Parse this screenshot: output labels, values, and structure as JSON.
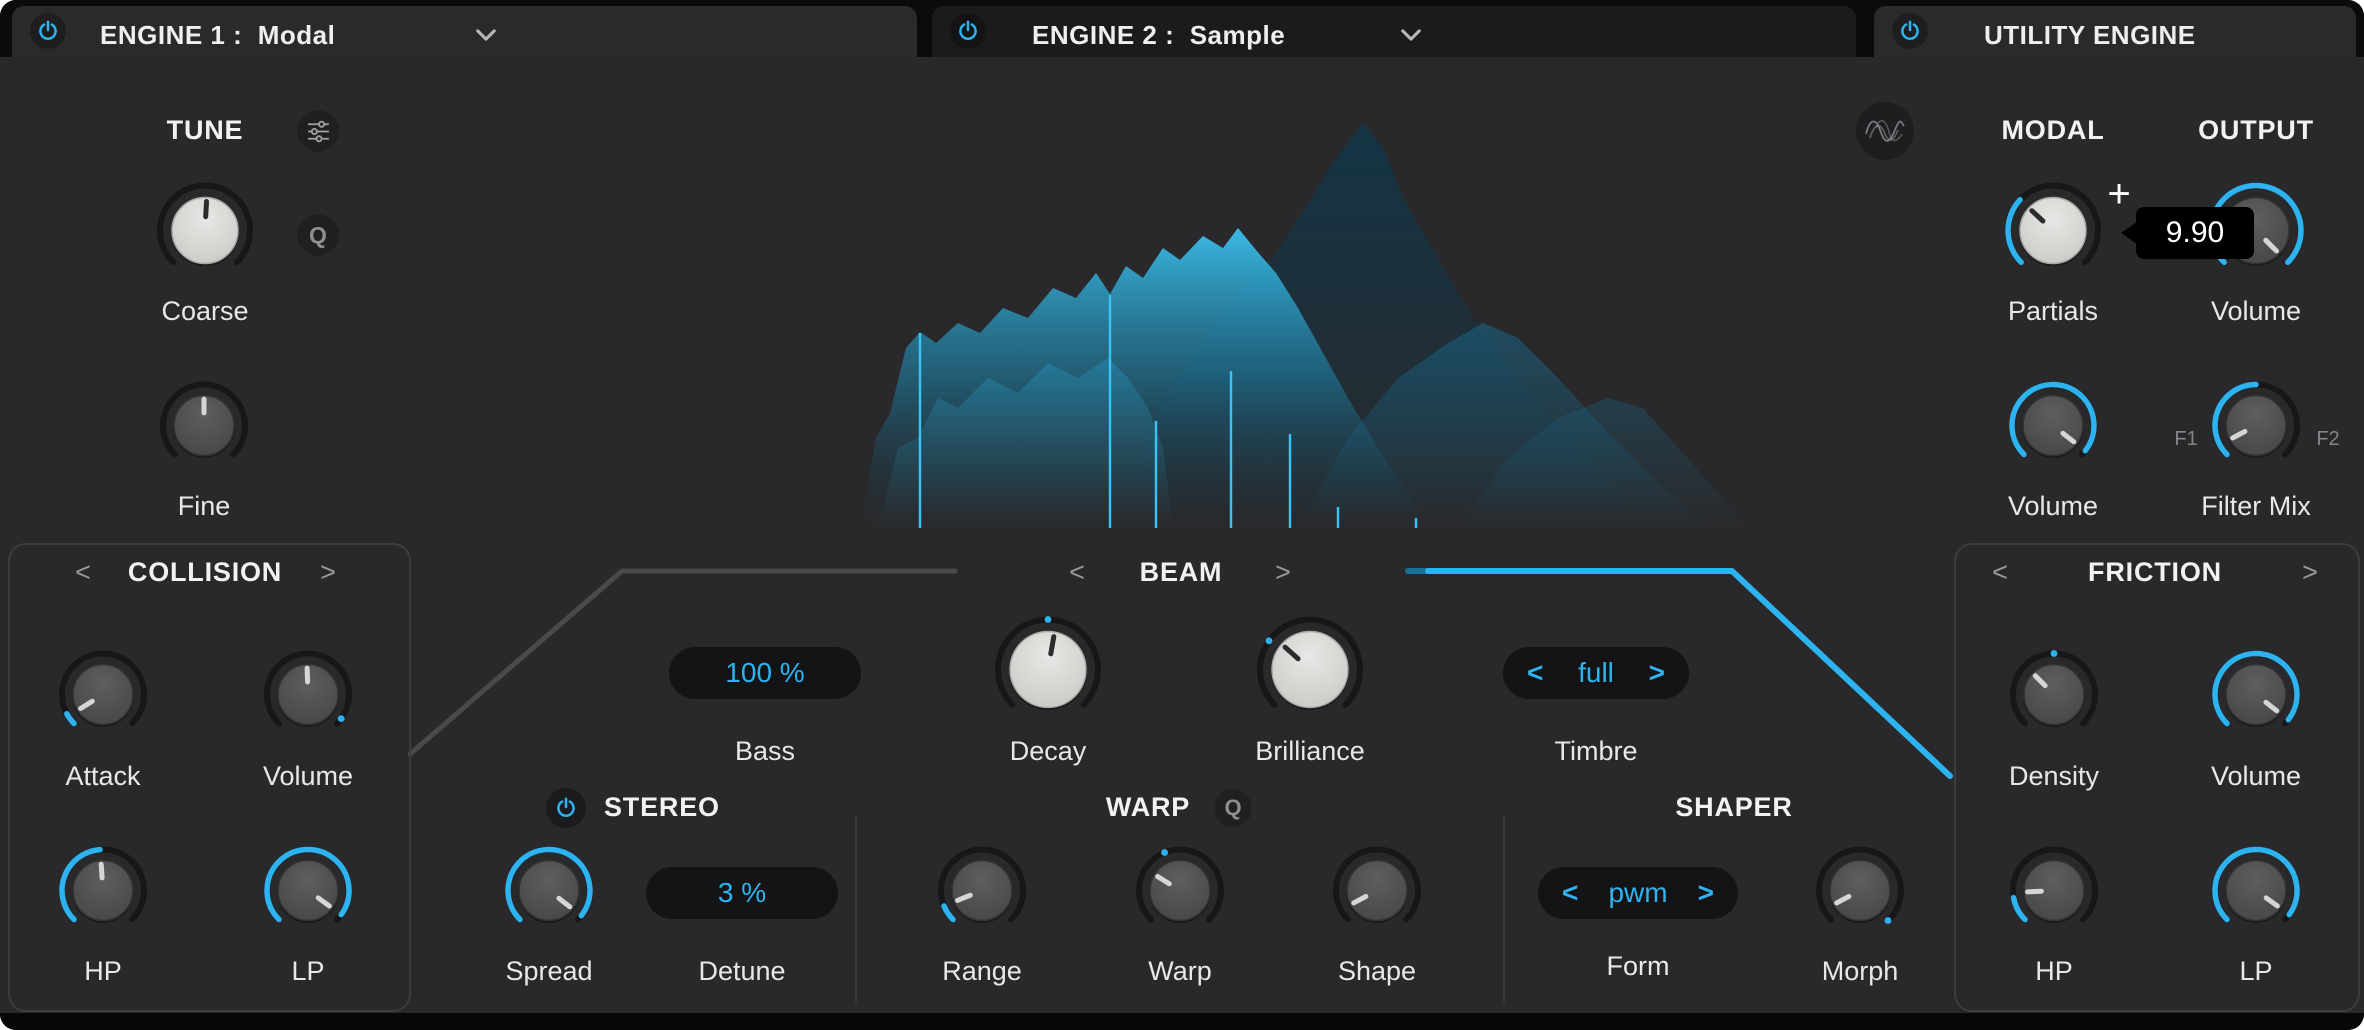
{
  "accent": "#2db4f0",
  "ui": {
    "prev": "<",
    "next": ">",
    "plus": "+"
  },
  "tabs": [
    {
      "label": "ENGINE 1 :  Modal"
    },
    {
      "label": "ENGINE 2 :  Sample"
    },
    {
      "label": "UTILITY ENGINE"
    }
  ],
  "sections": {
    "tune": "TUNE",
    "collision": "COLLISION",
    "beam": "BEAM",
    "stereo": "STEREO",
    "warp": "WARP",
    "shaper": "SHAPER",
    "modal": "MODAL",
    "output": "OUTPUT",
    "friction": "FRICTION"
  },
  "buttons": {
    "quantize_tune": "Q",
    "quantize_warp": "Q"
  },
  "fields": {
    "bass": {
      "label": "Bass",
      "value": "100 %"
    },
    "timbre": {
      "label": "Timbre",
      "value": "full"
    },
    "detune": {
      "label": "Detune",
      "value": "3 %"
    },
    "form": {
      "label": "Form",
      "value": "pwm"
    }
  },
  "tooltip": {
    "value": "9.90"
  },
  "filter_mix_labels": {
    "min": "F1",
    "max": "F2"
  },
  "knobs": {
    "coarse": {
      "label": "Coarse",
      "style": "light",
      "size": "m",
      "deg": 3,
      "arc": null,
      "ticks": []
    },
    "fine": {
      "label": "Fine",
      "style": "gray",
      "size": "s",
      "deg": 0,
      "arc": null,
      "ticks": []
    },
    "col_attack": {
      "label": "Attack",
      "style": "gray",
      "size": "s",
      "deg": -122,
      "arc": [
        -135,
        -118
      ],
      "ticks": []
    },
    "col_volume": {
      "label": "Volume",
      "style": "gray",
      "size": "s",
      "deg": -2,
      "arc": null,
      "ticks": [
        126
      ]
    },
    "col_hp": {
      "label": "HP",
      "style": "gray",
      "size": "s",
      "deg": -4,
      "arc": [
        -135,
        -4
      ],
      "ticks": []
    },
    "col_lp": {
      "label": "LP",
      "style": "gray",
      "size": "s",
      "deg": 126,
      "arc": [
        -135,
        126
      ],
      "ticks": []
    },
    "decay": {
      "label": "Decay",
      "style": "light",
      "size": "l",
      "deg": 10,
      "arc": null,
      "ticks": [
        0
      ]
    },
    "brilliance": {
      "label": "Brilliance",
      "style": "light",
      "size": "l",
      "deg": -48,
      "arc": null,
      "ticks": [
        -55
      ]
    },
    "spread": {
      "label": "Spread",
      "style": "gray",
      "size": "s",
      "deg": 128,
      "arc": [
        -135,
        128
      ],
      "ticks": []
    },
    "range": {
      "label": "Range",
      "style": "gray",
      "size": "s",
      "deg": -112,
      "arc": [
        -135,
        -112
      ],
      "ticks": []
    },
    "warp": {
      "label": "Warp",
      "style": "gray",
      "size": "s",
      "deg": -58,
      "arc": null,
      "ticks": [
        -22
      ]
    },
    "shape": {
      "label": "Shape",
      "style": "gray",
      "size": "s",
      "deg": -118,
      "arc": null,
      "ticks": []
    },
    "morph": {
      "label": "Morph",
      "style": "gray",
      "size": "s",
      "deg": -118,
      "arc": null,
      "ticks": [
        137
      ]
    },
    "partials": {
      "label": "Partials",
      "style": "light",
      "size": "m",
      "deg": -47,
      "arc": [
        -135,
        -47
      ],
      "ticks": []
    },
    "out_volume": {
      "label": "Volume",
      "style": "gray",
      "size": "m",
      "deg": 135,
      "arc": [
        -135,
        135
      ],
      "ticks": []
    },
    "util_volume": {
      "label": "Volume",
      "style": "gray",
      "size": "s",
      "deg": 128,
      "arc": [
        -135,
        128
      ],
      "ticks": []
    },
    "filter_mix": {
      "label": "Filter Mix",
      "style": "gray",
      "size": "s",
      "deg": -118,
      "arc": [
        -135,
        0
      ],
      "ticks": []
    },
    "density": {
      "label": "Density",
      "style": "gray",
      "size": "s",
      "deg": -45,
      "arc": null,
      "ticks": [
        0
      ]
    },
    "fric_volume": {
      "label": "Volume",
      "style": "gray",
      "size": "s",
      "deg": 128,
      "arc": [
        -135,
        128
      ],
      "ticks": []
    },
    "fric_hp": {
      "label": "HP",
      "style": "gray",
      "size": "s",
      "deg": -93,
      "arc": [
        -135,
        -100
      ],
      "ticks": []
    },
    "fric_lp": {
      "label": "LP",
      "style": "gray",
      "size": "s",
      "deg": 126,
      "arc": [
        -135,
        126
      ],
      "ticks": []
    }
  }
}
